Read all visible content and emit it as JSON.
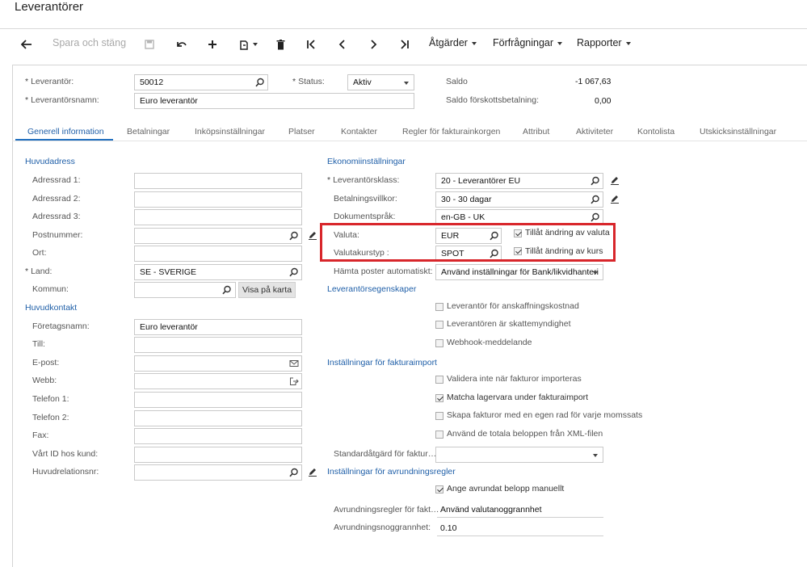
{
  "page": {
    "title": "Leverantörer"
  },
  "toolbar": {
    "save_close": "Spara och stäng",
    "actions": "Åtgärder",
    "inquiries": "Förfrågningar",
    "reports": "Rapporter"
  },
  "header": {
    "vendor_label": "Leverantör:",
    "vendor_value": "50012",
    "vendor_name_label": "Leverantörsnamn:",
    "vendor_name_value": "Euro leverantör",
    "status_label": "Status:",
    "status_value": "Aktiv",
    "balance_label": "Saldo",
    "balance_value": "-1 067,63",
    "prepayment_label": "Saldo förskottsbetalning:",
    "prepayment_value": "0,00"
  },
  "tabs": [
    {
      "label": "Generell information",
      "active": true
    },
    {
      "label": "Betalningar"
    },
    {
      "label": "Inköpsinställningar"
    },
    {
      "label": "Platser"
    },
    {
      "label": "Kontakter"
    },
    {
      "label": "Regler för fakturainkorgen"
    },
    {
      "label": "Attribut"
    },
    {
      "label": "Aktiviteter"
    },
    {
      "label": "Kontolista"
    },
    {
      "label": "Utskicksinställningar"
    }
  ],
  "main_address": {
    "title": "Huvudadress",
    "addr1_label": "Adressrad 1:",
    "addr2_label": "Adressrad 2:",
    "addr3_label": "Adressrad 3:",
    "postal_label": "Postnummer:",
    "city_label": "Ort:",
    "country_label": "Land:",
    "country_value": "SE - SVERIGE",
    "county_label": "Kommun:",
    "map_button": "Visa på karta"
  },
  "main_contact": {
    "title": "Huvudkontakt",
    "company_label": "Företagsnamn:",
    "company_value": "Euro leverantör",
    "attention_label": "Till:",
    "email_label": "E-post:",
    "web_label": "Webb:",
    "phone1_label": "Telefon 1:",
    "phone2_label": "Telefon 2:",
    "fax_label": "Fax:",
    "our_id_label": "Vårt ID hos kund:",
    "parent_label": "Huvudrelationsnr:"
  },
  "financial": {
    "title": "Ekonomiinställningar",
    "vendor_class_label": "Leverantörsklass:",
    "vendor_class_value": "20 - Leverantörer EU",
    "terms_label": "Betalningsvillkor:",
    "terms_value": "30 - 30 dagar",
    "doc_lang_label": "Dokumentspråk:",
    "doc_lang_value": "en-GB - UK",
    "currency_label": "Valuta:",
    "currency_value": "EUR",
    "allow_currency_override": "Tillåt ändring av valuta",
    "rate_type_label": "Valutakurstyp :",
    "rate_type_value": "SPOT",
    "allow_rate_override": "Tillåt ändring av kurs",
    "fetch_label": "Hämta poster automatiskt:",
    "fetch_value": "Använd inställningar för Bank/likvidhanteri"
  },
  "vendor_props": {
    "title": "Leverantörsegenskaper",
    "landed_cost": "Leverantör för anskaffningskostnad",
    "tax_agency": "Leverantören är skattemyndighet",
    "webhook": "Webhook-meddelande"
  },
  "invoice_import": {
    "title": "Inställningar för fakturaimport",
    "no_validate": "Validera inte när fakturor importeras",
    "match_items": "Matcha lagervara under fakturaimport",
    "line_per_vat": "Skapa fakturor med en egen rad för varje momssats",
    "use_totals": "Använd de totala beloppen från XML-filen",
    "default_action_label": "Standardåtgärd för faktur…"
  },
  "rounding": {
    "title": "Inställningar för avrundningsregler",
    "manual": "Ange avrundat belopp manuellt",
    "rules_label": "Avrundningsregler för fakt…",
    "rules_value": "Använd valutanoggrannhet",
    "precision_label": "Avrundningsnoggrannhet:",
    "precision_value": "0.10"
  }
}
